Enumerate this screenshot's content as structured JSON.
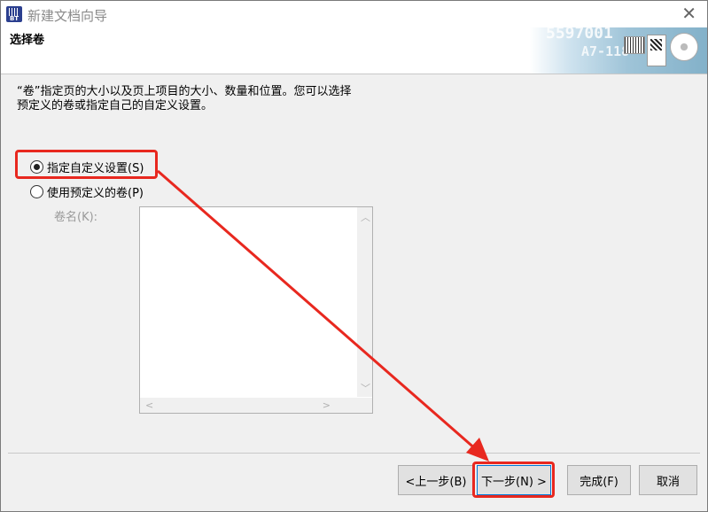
{
  "window": {
    "title": "新建文档向导",
    "close_glyph": "✕"
  },
  "header": {
    "step_title": "选择卷",
    "banner": {
      "number_1": "5597001",
      "number_2": "A7-118"
    }
  },
  "description": {
    "line1": "“卷”指定页的大小以及页上项目的大小、数量和位置。您可以选择",
    "line2": "预定义的卷或指定自己的自定义设置。"
  },
  "options": {
    "custom": {
      "label": "指定自定义设置(S)",
      "checked": true
    },
    "predefined": {
      "label": "使用预定义的卷(P)",
      "checked": false
    }
  },
  "volume_list": {
    "label": "卷名(K):",
    "items": []
  },
  "buttons": {
    "prev": "<上一步(B)",
    "next": "下一步(N) >",
    "finish": "完成(F)",
    "cancel": "取消"
  },
  "annotation": {
    "color": "#e8281f"
  }
}
